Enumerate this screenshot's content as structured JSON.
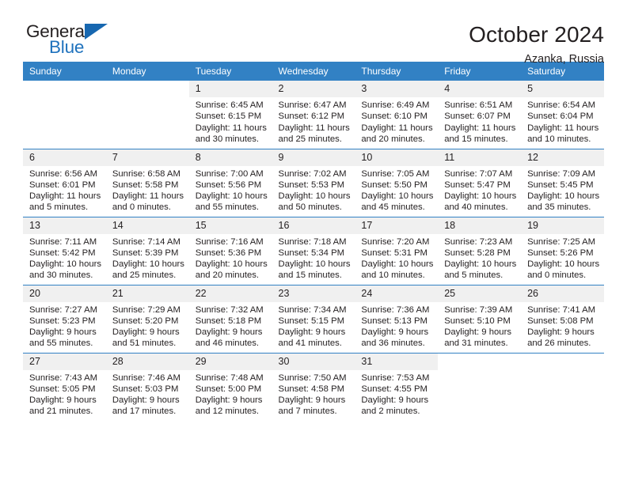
{
  "brand": {
    "name_part1": "General",
    "name_part2": "Blue",
    "accent_color": "#1767b0"
  },
  "header": {
    "title": "October 2024",
    "location": "Azanka, Russia"
  },
  "theme": {
    "header_blue": "#3281c4",
    "daynum_gray": "#f0f0f0",
    "text": "#231f20"
  },
  "weekday_headers": [
    "Sunday",
    "Monday",
    "Tuesday",
    "Wednesday",
    "Thursday",
    "Friday",
    "Saturday"
  ],
  "weeks": [
    [
      {
        "day": "",
        "blank": true,
        "sunrise": "",
        "sunset": "",
        "daylight1": "",
        "daylight2": ""
      },
      {
        "day": "",
        "blank": true,
        "sunrise": "",
        "sunset": "",
        "daylight1": "",
        "daylight2": ""
      },
      {
        "day": "1",
        "sunrise": "Sunrise: 6:45 AM",
        "sunset": "Sunset: 6:15 PM",
        "daylight1": "Daylight: 11 hours",
        "daylight2": "and 30 minutes."
      },
      {
        "day": "2",
        "sunrise": "Sunrise: 6:47 AM",
        "sunset": "Sunset: 6:12 PM",
        "daylight1": "Daylight: 11 hours",
        "daylight2": "and 25 minutes."
      },
      {
        "day": "3",
        "sunrise": "Sunrise: 6:49 AM",
        "sunset": "Sunset: 6:10 PM",
        "daylight1": "Daylight: 11 hours",
        "daylight2": "and 20 minutes."
      },
      {
        "day": "4",
        "sunrise": "Sunrise: 6:51 AM",
        "sunset": "Sunset: 6:07 PM",
        "daylight1": "Daylight: 11 hours",
        "daylight2": "and 15 minutes."
      },
      {
        "day": "5",
        "sunrise": "Sunrise: 6:54 AM",
        "sunset": "Sunset: 6:04 PM",
        "daylight1": "Daylight: 11 hours",
        "daylight2": "and 10 minutes."
      }
    ],
    [
      {
        "day": "6",
        "sunrise": "Sunrise: 6:56 AM",
        "sunset": "Sunset: 6:01 PM",
        "daylight1": "Daylight: 11 hours",
        "daylight2": "and 5 minutes."
      },
      {
        "day": "7",
        "sunrise": "Sunrise: 6:58 AM",
        "sunset": "Sunset: 5:58 PM",
        "daylight1": "Daylight: 11 hours",
        "daylight2": "and 0 minutes."
      },
      {
        "day": "8",
        "sunrise": "Sunrise: 7:00 AM",
        "sunset": "Sunset: 5:56 PM",
        "daylight1": "Daylight: 10 hours",
        "daylight2": "and 55 minutes."
      },
      {
        "day": "9",
        "sunrise": "Sunrise: 7:02 AM",
        "sunset": "Sunset: 5:53 PM",
        "daylight1": "Daylight: 10 hours",
        "daylight2": "and 50 minutes."
      },
      {
        "day": "10",
        "sunrise": "Sunrise: 7:05 AM",
        "sunset": "Sunset: 5:50 PM",
        "daylight1": "Daylight: 10 hours",
        "daylight2": "and 45 minutes."
      },
      {
        "day": "11",
        "sunrise": "Sunrise: 7:07 AM",
        "sunset": "Sunset: 5:47 PM",
        "daylight1": "Daylight: 10 hours",
        "daylight2": "and 40 minutes."
      },
      {
        "day": "12",
        "sunrise": "Sunrise: 7:09 AM",
        "sunset": "Sunset: 5:45 PM",
        "daylight1": "Daylight: 10 hours",
        "daylight2": "and 35 minutes."
      }
    ],
    [
      {
        "day": "13",
        "sunrise": "Sunrise: 7:11 AM",
        "sunset": "Sunset: 5:42 PM",
        "daylight1": "Daylight: 10 hours",
        "daylight2": "and 30 minutes."
      },
      {
        "day": "14",
        "sunrise": "Sunrise: 7:14 AM",
        "sunset": "Sunset: 5:39 PM",
        "daylight1": "Daylight: 10 hours",
        "daylight2": "and 25 minutes."
      },
      {
        "day": "15",
        "sunrise": "Sunrise: 7:16 AM",
        "sunset": "Sunset: 5:36 PM",
        "daylight1": "Daylight: 10 hours",
        "daylight2": "and 20 minutes."
      },
      {
        "day": "16",
        "sunrise": "Sunrise: 7:18 AM",
        "sunset": "Sunset: 5:34 PM",
        "daylight1": "Daylight: 10 hours",
        "daylight2": "and 15 minutes."
      },
      {
        "day": "17",
        "sunrise": "Sunrise: 7:20 AM",
        "sunset": "Sunset: 5:31 PM",
        "daylight1": "Daylight: 10 hours",
        "daylight2": "and 10 minutes."
      },
      {
        "day": "18",
        "sunrise": "Sunrise: 7:23 AM",
        "sunset": "Sunset: 5:28 PM",
        "daylight1": "Daylight: 10 hours",
        "daylight2": "and 5 minutes."
      },
      {
        "day": "19",
        "sunrise": "Sunrise: 7:25 AM",
        "sunset": "Sunset: 5:26 PM",
        "daylight1": "Daylight: 10 hours",
        "daylight2": "and 0 minutes."
      }
    ],
    [
      {
        "day": "20",
        "sunrise": "Sunrise: 7:27 AM",
        "sunset": "Sunset: 5:23 PM",
        "daylight1": "Daylight: 9 hours",
        "daylight2": "and 55 minutes."
      },
      {
        "day": "21",
        "sunrise": "Sunrise: 7:29 AM",
        "sunset": "Sunset: 5:20 PM",
        "daylight1": "Daylight: 9 hours",
        "daylight2": "and 51 minutes."
      },
      {
        "day": "22",
        "sunrise": "Sunrise: 7:32 AM",
        "sunset": "Sunset: 5:18 PM",
        "daylight1": "Daylight: 9 hours",
        "daylight2": "and 46 minutes."
      },
      {
        "day": "23",
        "sunrise": "Sunrise: 7:34 AM",
        "sunset": "Sunset: 5:15 PM",
        "daylight1": "Daylight: 9 hours",
        "daylight2": "and 41 minutes."
      },
      {
        "day": "24",
        "sunrise": "Sunrise: 7:36 AM",
        "sunset": "Sunset: 5:13 PM",
        "daylight1": "Daylight: 9 hours",
        "daylight2": "and 36 minutes."
      },
      {
        "day": "25",
        "sunrise": "Sunrise: 7:39 AM",
        "sunset": "Sunset: 5:10 PM",
        "daylight1": "Daylight: 9 hours",
        "daylight2": "and 31 minutes."
      },
      {
        "day": "26",
        "sunrise": "Sunrise: 7:41 AM",
        "sunset": "Sunset: 5:08 PM",
        "daylight1": "Daylight: 9 hours",
        "daylight2": "and 26 minutes."
      }
    ],
    [
      {
        "day": "27",
        "sunrise": "Sunrise: 7:43 AM",
        "sunset": "Sunset: 5:05 PM",
        "daylight1": "Daylight: 9 hours",
        "daylight2": "and 21 minutes."
      },
      {
        "day": "28",
        "sunrise": "Sunrise: 7:46 AM",
        "sunset": "Sunset: 5:03 PM",
        "daylight1": "Daylight: 9 hours",
        "daylight2": "and 17 minutes."
      },
      {
        "day": "29",
        "sunrise": "Sunrise: 7:48 AM",
        "sunset": "Sunset: 5:00 PM",
        "daylight1": "Daylight: 9 hours",
        "daylight2": "and 12 minutes."
      },
      {
        "day": "30",
        "sunrise": "Sunrise: 7:50 AM",
        "sunset": "Sunset: 4:58 PM",
        "daylight1": "Daylight: 9 hours",
        "daylight2": "and 7 minutes."
      },
      {
        "day": "31",
        "sunrise": "Sunrise: 7:53 AM",
        "sunset": "Sunset: 4:55 PM",
        "daylight1": "Daylight: 9 hours",
        "daylight2": "and 2 minutes."
      },
      {
        "day": "",
        "blank": true,
        "sunrise": "",
        "sunset": "",
        "daylight1": "",
        "daylight2": ""
      },
      {
        "day": "",
        "blank": true,
        "sunrise": "",
        "sunset": "",
        "daylight1": "",
        "daylight2": ""
      }
    ]
  ]
}
